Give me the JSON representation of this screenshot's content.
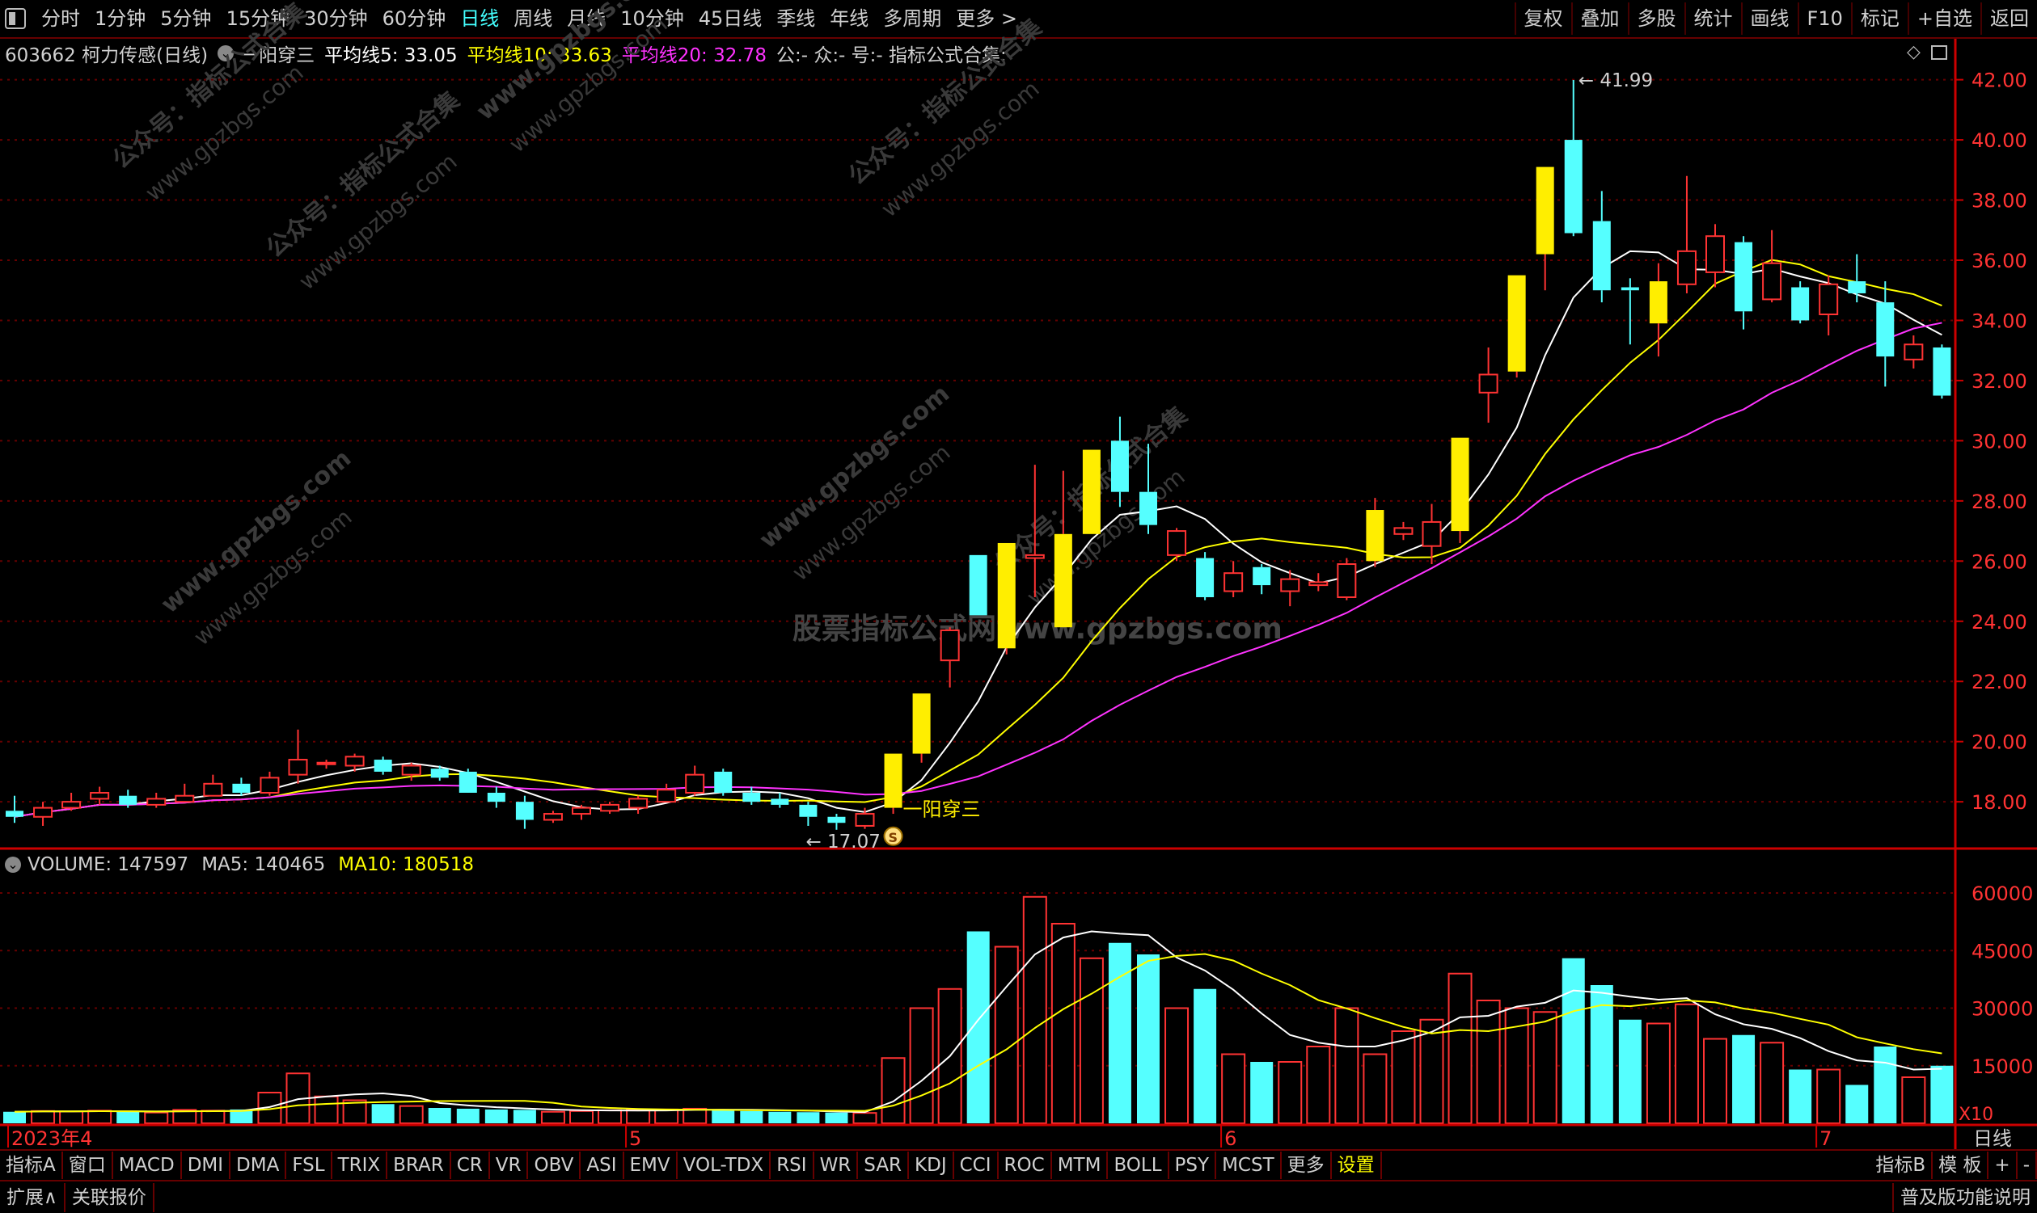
{
  "toolbar": {
    "periods": [
      "分时",
      "1分钟",
      "5分钟",
      "15分钟",
      "30分钟",
      "60分钟",
      "日线",
      "周线",
      "月线",
      "10分钟",
      "45日线",
      "季线",
      "年线",
      "多周期",
      "更多 >"
    ],
    "active_period": "日线",
    "right_buttons": [
      "复权",
      "叠加",
      "多股",
      "统计",
      "画线",
      "F10",
      "标记",
      "+自选",
      "返回"
    ]
  },
  "legend": {
    "title": "603662 柯力传感(日线)",
    "indicator": "一阳穿三",
    "ma5": "平均线5: 33.05",
    "ma10": "平均线10: 33.63",
    "ma20": "平均线20: 32.78",
    "extra": "公:- 众:- 号:- 指标公式合集:-"
  },
  "volume_legend": {
    "volume": "VOLUME: 147597",
    "ma5": "MA5: 140465",
    "ma10": "MA10: 180518"
  },
  "price_axis_labels": [
    "42.00",
    "40.00",
    "38.00",
    "36.00",
    "34.00",
    "32.00",
    "30.00",
    "28.00",
    "26.00",
    "24.00",
    "22.00",
    "20.00",
    "18.00"
  ],
  "volume_axis_labels": [
    "60000",
    "45000",
    "30000",
    "15000"
  ],
  "volume_unit": "X10",
  "date_labels": [
    "2023年4",
    "5",
    "6",
    "7"
  ],
  "period_label": "日线",
  "annotations": {
    "high": "41.99",
    "low": "17.07",
    "signal": "一阳穿三",
    "signal_mark": "S"
  },
  "watermarks": [
    "公众号：指标公式合集",
    "www.gpzbgs.com",
    "股票指标公式网www.gpzbgs.com"
  ],
  "tabs": [
    "指标A",
    "窗口",
    "MACD",
    "DMI",
    "DMA",
    "FSL",
    "TRIX",
    "BRAR",
    "CR",
    "VR",
    "OBV",
    "ASI",
    "EMV",
    "VOL-TDX",
    "RSI",
    "WR",
    "SAR",
    "KDJ",
    "CCI",
    "ROC",
    "MTM",
    "BOLL",
    "PSY",
    "MCST",
    "更多",
    "设置"
  ],
  "tabs_right": [
    "指标B",
    "模 板",
    "+",
    "-"
  ],
  "status": {
    "left": [
      "扩展∧",
      "关联报价"
    ],
    "right": "普及版功能说明"
  },
  "colors": {
    "up": "#ff3333",
    "up_fill": "#ffee00",
    "down": "#55ffff",
    "ma5": "#ffffff",
    "ma10": "#ffff00",
    "ma20": "#ff33ff",
    "axis": "#cc0000",
    "grid": "#660000"
  },
  "chart_data": {
    "type": "candlestick",
    "title": "603662 柯力传感(日线)",
    "y_range": [
      16.5,
      42.5
    ],
    "volume_range": [
      0,
      64000
    ],
    "candles": [
      {
        "o": 17.7,
        "h": 18.2,
        "l": 17.3,
        "c": 17.5,
        "v": 3000
      },
      {
        "o": 17.5,
        "h": 18.0,
        "l": 17.2,
        "c": 17.8,
        "v": 3200
      },
      {
        "o": 17.8,
        "h": 18.3,
        "l": 17.7,
        "c": 18.0,
        "v": 3100
      },
      {
        "o": 18.1,
        "h": 18.5,
        "l": 17.9,
        "c": 18.3,
        "v": 3300
      },
      {
        "o": 18.2,
        "h": 18.4,
        "l": 17.8,
        "c": 17.9,
        "v": 3000
      },
      {
        "o": 17.9,
        "h": 18.3,
        "l": 17.8,
        "c": 18.1,
        "v": 2800
      },
      {
        "o": 18.0,
        "h": 18.6,
        "l": 18.0,
        "c": 18.2,
        "v": 3500
      },
      {
        "o": 18.2,
        "h": 18.9,
        "l": 18.2,
        "c": 18.6,
        "v": 3300
      },
      {
        "o": 18.6,
        "h": 18.8,
        "l": 18.2,
        "c": 18.3,
        "v": 3600
      },
      {
        "o": 18.3,
        "h": 19.0,
        "l": 18.2,
        "c": 18.8,
        "v": 8000
      },
      {
        "o": 18.9,
        "h": 20.4,
        "l": 18.6,
        "c": 19.4,
        "v": 13000
      },
      {
        "o": 19.3,
        "h": 19.4,
        "l": 19.1,
        "c": 19.3,
        "v": 7000
      },
      {
        "o": 19.2,
        "h": 19.6,
        "l": 19.0,
        "c": 19.5,
        "v": 6000
      },
      {
        "o": 19.4,
        "h": 19.5,
        "l": 18.9,
        "c": 19.0,
        "v": 5000
      },
      {
        "o": 18.9,
        "h": 19.3,
        "l": 18.7,
        "c": 19.2,
        "v": 4500
      },
      {
        "o": 19.1,
        "h": 19.2,
        "l": 18.7,
        "c": 18.8,
        "v": 4000
      },
      {
        "o": 19.0,
        "h": 19.1,
        "l": 18.5,
        "c": 18.3,
        "v": 3800
      },
      {
        "o": 18.3,
        "h": 18.5,
        "l": 17.8,
        "c": 18.0,
        "v": 3600
      },
      {
        "o": 18.0,
        "h": 18.2,
        "l": 17.1,
        "c": 17.4,
        "v": 3500
      },
      {
        "o": 17.4,
        "h": 17.7,
        "l": 17.3,
        "c": 17.6,
        "v": 3000
      },
      {
        "o": 17.6,
        "h": 17.9,
        "l": 17.4,
        "c": 17.8,
        "v": 3200
      },
      {
        "o": 17.7,
        "h": 18.0,
        "l": 17.6,
        "c": 17.9,
        "v": 3400
      },
      {
        "o": 17.8,
        "h": 18.2,
        "l": 17.6,
        "c": 18.1,
        "v": 3500
      },
      {
        "o": 18.0,
        "h": 18.6,
        "l": 18.0,
        "c": 18.4,
        "v": 3600
      },
      {
        "o": 18.3,
        "h": 19.2,
        "l": 18.2,
        "c": 18.9,
        "v": 3800
      },
      {
        "o": 19.0,
        "h": 19.1,
        "l": 18.2,
        "c": 18.3,
        "v": 3500
      },
      {
        "o": 18.3,
        "h": 18.5,
        "l": 17.9,
        "c": 18.0,
        "v": 3200
      },
      {
        "o": 18.1,
        "h": 18.3,
        "l": 17.8,
        "c": 17.9,
        "v": 3000
      },
      {
        "o": 17.9,
        "h": 18.0,
        "l": 17.2,
        "c": 17.5,
        "v": 2900
      },
      {
        "o": 17.5,
        "h": 17.6,
        "l": 17.07,
        "c": 17.3,
        "v": 2800
      },
      {
        "o": 17.2,
        "h": 17.8,
        "l": 17.1,
        "c": 17.6,
        "v": 2700
      },
      {
        "o": 17.8,
        "h": 19.6,
        "l": 17.6,
        "c": 19.6,
        "v": 17000
      },
      {
        "o": 19.6,
        "h": 21.6,
        "l": 19.3,
        "c": 21.6,
        "v": 30000
      },
      {
        "o": 22.7,
        "h": 23.8,
        "l": 21.8,
        "c": 23.7,
        "v": 35000
      },
      {
        "o": 26.2,
        "h": 26.2,
        "l": 24.2,
        "c": 24.2,
        "v": 50000
      },
      {
        "o": 23.1,
        "h": 26.6,
        "l": 22.9,
        "c": 26.6,
        "v": 46000
      },
      {
        "o": 26.1,
        "h": 29.2,
        "l": 24.8,
        "c": 26.2,
        "v": 59000
      },
      {
        "o": 23.8,
        "h": 29.0,
        "l": 23.8,
        "c": 26.9,
        "v": 52000
      },
      {
        "o": 26.9,
        "h": 29.7,
        "l": 26.9,
        "c": 29.7,
        "v": 43000
      },
      {
        "o": 30.0,
        "h": 30.8,
        "l": 27.8,
        "c": 28.3,
        "v": 47000
      },
      {
        "o": 28.3,
        "h": 29.9,
        "l": 26.9,
        "c": 27.2,
        "v": 44000
      },
      {
        "o": 26.2,
        "h": 27.1,
        "l": 26.0,
        "c": 27.0,
        "v": 30000
      },
      {
        "o": 26.1,
        "h": 26.3,
        "l": 24.7,
        "c": 24.8,
        "v": 35000
      },
      {
        "o": 25.0,
        "h": 26.0,
        "l": 24.8,
        "c": 25.6,
        "v": 18000
      },
      {
        "o": 25.8,
        "h": 25.9,
        "l": 24.9,
        "c": 25.2,
        "v": 16000
      },
      {
        "o": 25.0,
        "h": 25.7,
        "l": 24.5,
        "c": 25.4,
        "v": 16000
      },
      {
        "o": 25.2,
        "h": 25.6,
        "l": 25.0,
        "c": 25.3,
        "v": 20000
      },
      {
        "o": 24.8,
        "h": 26.1,
        "l": 24.7,
        "c": 25.9,
        "v": 30000
      },
      {
        "o": 26.0,
        "h": 28.1,
        "l": 25.8,
        "c": 27.7,
        "v": 18000
      },
      {
        "o": 26.9,
        "h": 27.3,
        "l": 26.7,
        "c": 27.1,
        "v": 24000
      },
      {
        "o": 26.5,
        "h": 27.9,
        "l": 25.9,
        "c": 27.3,
        "v": 27000
      },
      {
        "o": 27.0,
        "h": 30.1,
        "l": 26.6,
        "c": 30.1,
        "v": 39000
      },
      {
        "o": 31.6,
        "h": 33.1,
        "l": 30.6,
        "c": 32.2,
        "v": 32000
      },
      {
        "o": 32.3,
        "h": 35.5,
        "l": 32.1,
        "c": 35.5,
        "v": 30000
      },
      {
        "o": 36.2,
        "h": 39.1,
        "l": 35.0,
        "c": 39.1,
        "v": 29000
      },
      {
        "o": 40.0,
        "h": 41.99,
        "l": 36.8,
        "c": 36.9,
        "v": 43000
      },
      {
        "o": 37.3,
        "h": 38.3,
        "l": 34.6,
        "c": 35.0,
        "v": 36000
      },
      {
        "o": 35.1,
        "h": 35.4,
        "l": 33.2,
        "c": 35.0,
        "v": 27000
      },
      {
        "o": 33.9,
        "h": 35.9,
        "l": 32.8,
        "c": 35.3,
        "v": 26000
      },
      {
        "o": 35.2,
        "h": 38.8,
        "l": 34.9,
        "c": 36.3,
        "v": 31000
      },
      {
        "o": 35.6,
        "h": 37.2,
        "l": 35.1,
        "c": 36.8,
        "v": 22000
      },
      {
        "o": 36.6,
        "h": 36.8,
        "l": 33.7,
        "c": 34.3,
        "v": 23000
      },
      {
        "o": 34.7,
        "h": 37.0,
        "l": 34.6,
        "c": 35.9,
        "v": 21000
      },
      {
        "o": 35.1,
        "h": 35.3,
        "l": 33.9,
        "c": 34.0,
        "v": 14000
      },
      {
        "o": 34.2,
        "h": 35.5,
        "l": 33.5,
        "c": 35.2,
        "v": 14000
      },
      {
        "o": 35.3,
        "h": 36.2,
        "l": 34.6,
        "c": 34.9,
        "v": 10000
      },
      {
        "o": 34.6,
        "h": 35.3,
        "l": 31.8,
        "c": 32.8,
        "v": 20000
      },
      {
        "o": 32.7,
        "h": 33.5,
        "l": 32.4,
        "c": 33.2,
        "v": 12000
      },
      {
        "o": 33.1,
        "h": 33.2,
        "l": 31.4,
        "c": 31.5,
        "v": 15000
      }
    ]
  }
}
